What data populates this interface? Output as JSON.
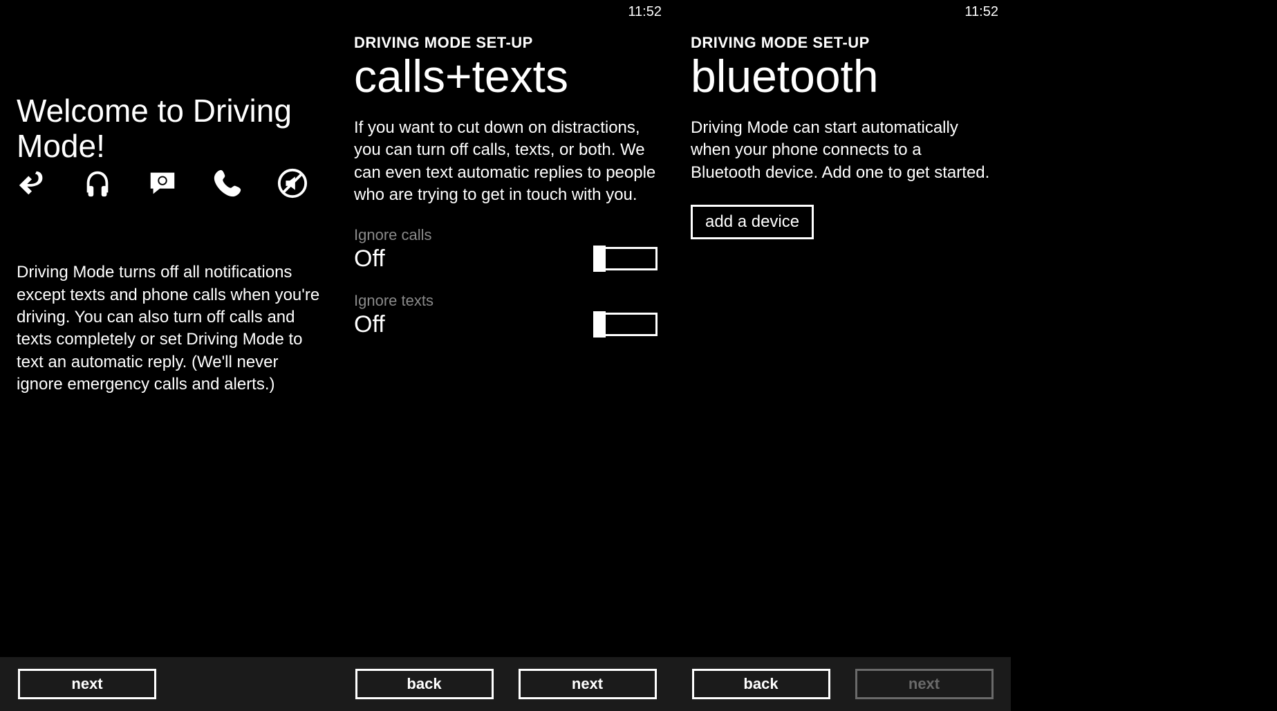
{
  "time": "11:52",
  "panel1": {
    "title": "Welcome to Driving Mode!",
    "body": "Driving Mode turns off all notifications except texts and phone calls when you're driving. You can also turn off calls and texts completely or set Driving Mode to text an automatic reply. (We'll never ignore emergency calls and alerts.)",
    "next": "next"
  },
  "panel2": {
    "category": "DRIVING MODE SET-UP",
    "title": "calls+texts",
    "body": "If you want to cut down on distractions, you can turn off calls, texts, or both. We can even text automatic replies to people who are trying to get in touch with you.",
    "ignore_calls_label": "Ignore calls",
    "ignore_calls_value": "Off",
    "ignore_texts_label": "Ignore texts",
    "ignore_texts_value": "Off",
    "back": "back",
    "next": "next"
  },
  "panel3": {
    "category": "DRIVING MODE SET-UP",
    "title": "bluetooth",
    "body": "Driving Mode can start automatically when your phone connects to a Bluetooth device. Add one to get started.",
    "add_device": "add a device",
    "back": "back",
    "next": "next"
  }
}
